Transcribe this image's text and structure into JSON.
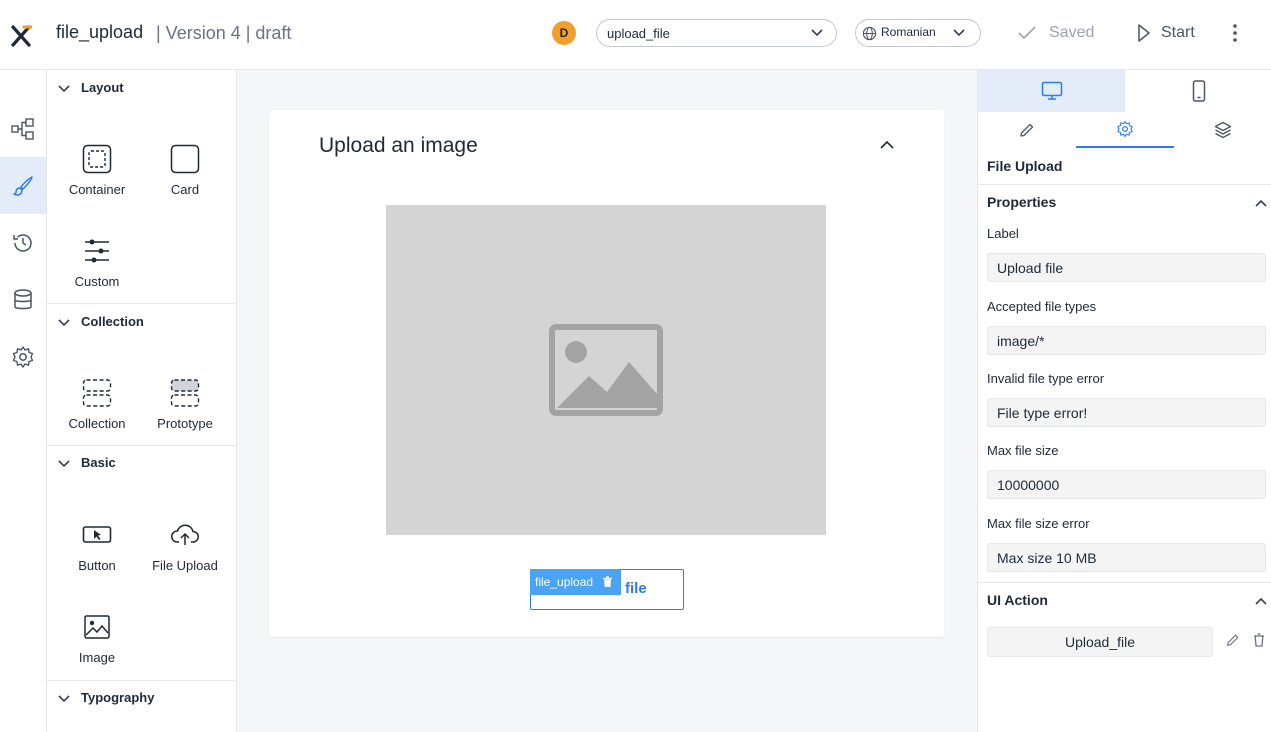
{
  "header": {
    "app_name": "file_upload",
    "version_info": "| Version 4 | draft",
    "avatar_initial": "D",
    "flow_select": "upload_file",
    "language_select": "Romanian",
    "saved_label": "Saved",
    "start_label": "Start"
  },
  "rail": {
    "items": [
      "flow-icon",
      "brush-icon",
      "history-icon",
      "database-icon",
      "settings-icon"
    ],
    "active": "brush-icon"
  },
  "palette": {
    "sections": {
      "layout": "Layout",
      "collection": "Collection",
      "basic": "Basic",
      "typography": "Typography"
    },
    "tiles": {
      "container": "Container",
      "card": "Card",
      "custom": "Custom",
      "collection": "Collection",
      "prototype": "Prototype",
      "button": "Button",
      "file_upload": "File Upload",
      "image": "Image"
    }
  },
  "canvas": {
    "card_title": "Upload an image",
    "upload_button_label": "file",
    "selection_tag": "file_upload"
  },
  "inspector": {
    "device_tabs": [
      "desktop-icon",
      "mobile-icon"
    ],
    "tool_tabs": [
      "edit-icon",
      "settings-icon",
      "layers-icon"
    ],
    "component_name": "File Upload",
    "properties_title": "Properties",
    "fields": {
      "label": {
        "label": "Label",
        "value": "Upload file"
      },
      "accepted_types": {
        "label": "Accepted file types",
        "value": "image/*"
      },
      "invalid_type_error": {
        "label": "Invalid file type error",
        "value": "File type error!"
      },
      "max_size": {
        "label": "Max file size",
        "value": "10000000"
      },
      "max_size_error": {
        "label": "Max file size error",
        "value": "Max size 10 MB"
      }
    },
    "ui_action_title": "UI Action",
    "ui_action_value": "Upload_file"
  },
  "colors": {
    "accent": "#2b7de9",
    "selection": "#4aa3f3",
    "avatar": "#f0a02a",
    "active_bg": "#e3ecf8"
  }
}
